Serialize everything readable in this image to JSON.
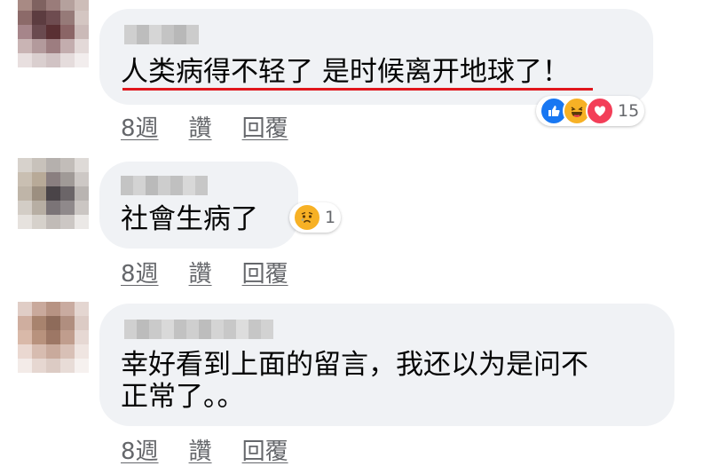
{
  "comments": [
    {
      "text": "人类病得不轻了 是时候离开地球了！",
      "reactions": {
        "icons": [
          "like-icon",
          "haha-icon",
          "love-icon"
        ],
        "count": "15"
      },
      "actions": {
        "time": "8週",
        "like": "讚",
        "reply": "回覆"
      }
    },
    {
      "text": "社會生病了",
      "reactions": {
        "icons": [
          "sad-icon"
        ],
        "count": "1"
      },
      "actions": {
        "time": "8週",
        "like": "讚",
        "reply": "回覆"
      }
    },
    {
      "text_line1": "幸好看到上面的留言，我还以为是问不",
      "text_line2": "正常了。。",
      "actions": {
        "time": "8週",
        "like": "讚",
        "reply": "回覆"
      }
    }
  ],
  "colors": {
    "bubble": "#f0f2f5",
    "underline": "#e0161c",
    "action_text": "#65676b",
    "like": "#1877f2",
    "love": "#f33e58",
    "haha": "#f7b125"
  }
}
